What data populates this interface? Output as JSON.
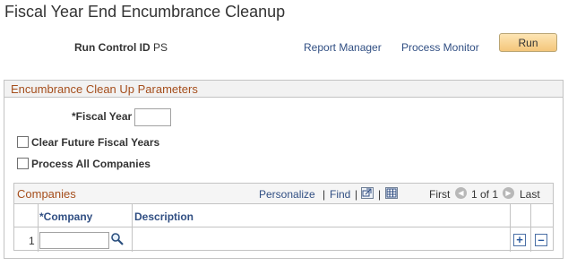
{
  "page": {
    "title": "Fiscal Year End Encumbrance Cleanup"
  },
  "run_control": {
    "label": "Run Control ID",
    "value": "PS",
    "report_manager": "Report Manager",
    "process_monitor": "Process Monitor",
    "run_label": "Run"
  },
  "params": {
    "title": "Encumbrance Clean Up Parameters",
    "fiscal_year_label": "*Fiscal Year",
    "fiscal_year_value": "",
    "clear_future_label": "Clear Future Fiscal Years",
    "clear_future_checked": false,
    "process_all_label": "Process All Companies",
    "process_all_checked": false
  },
  "companies": {
    "title": "Companies",
    "personalize": "Personalize",
    "find": "Find",
    "separator": "|",
    "first": "First",
    "pagination": "1 of 1",
    "last": "Last",
    "columns": [
      "*Company",
      "Description"
    ],
    "rows": [
      {
        "num": "1",
        "company": "",
        "description": ""
      }
    ]
  },
  "icons": {
    "lookup": "magnifier-icon",
    "view_all": "view-all-icon",
    "download": "spreadsheet-icon",
    "prev": "prev-arrow-icon",
    "next": "next-arrow-icon",
    "add_row": "plus-icon",
    "delete_row": "minus-icon"
  },
  "colors": {
    "group_title": "#a54e1c",
    "link": "#314f83",
    "run_button": "#f4c67a"
  }
}
